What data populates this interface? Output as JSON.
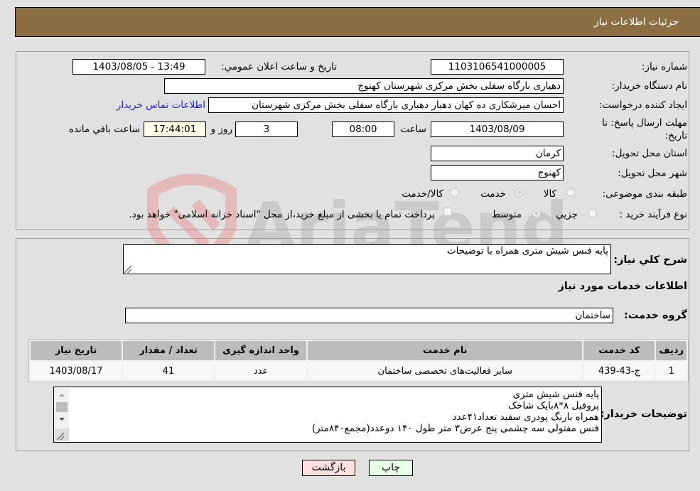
{
  "header": {
    "title": "جزئیات اطلاعات نیاز"
  },
  "form": {
    "need_number": {
      "label": "شماره نیاز:",
      "value": "1103106541000005"
    },
    "announce": {
      "label": "تاریخ و ساعت اعلان عمومي:",
      "value": "1403/08/05 - 13:49"
    },
    "buyer_org": {
      "label": "نام دستگاه خريدار:",
      "value": "دهیاری بارگاه سفلی بخش مرکزی شهرستان کهنوج"
    },
    "requester": {
      "label": "ایجاد کننده درخواست:",
      "value": "احسان میرشکاری ده کهان دهیار دهیاری بارگاه سفلی بخش مرکزی شهرستان",
      "contact_link": "اطلاعات تماس خریدار"
    },
    "deadline": {
      "label_line1": "مهلت ارسال پاسخ: تا",
      "label_line2": "تاریخ:",
      "date": "1403/08/09",
      "time_label": "ساعت",
      "time": "08:00",
      "days": "3",
      "days_label": "روز و",
      "remaining": "17:44:01",
      "remaining_label": "ساعت باقي مانده"
    },
    "province": {
      "label": "استان محل تحویل:",
      "value": "کرمان"
    },
    "city": {
      "label": "شهر محل تحویل:",
      "value": "کهنوج"
    },
    "category": {
      "label": "طبقه بندی موضوعی:",
      "options": [
        "کالا",
        "خدمت",
        "کالا/خدمت"
      ],
      "selected": "خدمت"
    },
    "process": {
      "label": "نوع فرآیند خرید :",
      "options": [
        "جزيي",
        "متوسط"
      ],
      "selected": "متوسط",
      "treasury_note": "پرداخت تمام یا بخشی از مبلغ خرید،از محل \"اسناد خزانه اسلامی\" خواهد بود."
    }
  },
  "summary": {
    "label": "شرح کلي نياز:",
    "value": "پایه فنس شیش متری همراه با توضیحات"
  },
  "services": {
    "section_title": "اطلاعات خدمات مورد نیاز",
    "group_label": "گروه خدمت:",
    "group_value": "ساختمان",
    "table": {
      "headers": [
        "ردیف",
        "کد خدمت",
        "نام خدمت",
        "واحد اندازه گیری",
        "تعداد / مقدار",
        "تاریخ نیاز"
      ],
      "rows": [
        [
          "1",
          "ج-43-439",
          "سایر فعالیت‌های تخصصی ساختمان",
          "عدد",
          "41",
          "1403/08/17"
        ]
      ]
    }
  },
  "buyer_notes": {
    "label": "توضیحات خریدار:",
    "lines": [
      "پایه فنس شیش متری",
      "پروفیل ۸*۸بایک شاخک",
      "همراه بارنگ پودری سفید تعداد۴۱عدد",
      "فنس مفتولی سه چشمی پنج عرض۳ متر طول ۱۴۰ دوعدد(مجمع۸۴۰متر)"
    ]
  },
  "buttons": {
    "print": "چاپ",
    "back": "بازگشت"
  },
  "watermark": {
    "text": "AriaTender.neT"
  },
  "colors": {
    "header_bg": "#8d6d42",
    "back_btn": "#ffe0e0",
    "print_btn": "#eaffea",
    "link": "#1f1fd0",
    "remaining_bg": "#ffffe8"
  }
}
